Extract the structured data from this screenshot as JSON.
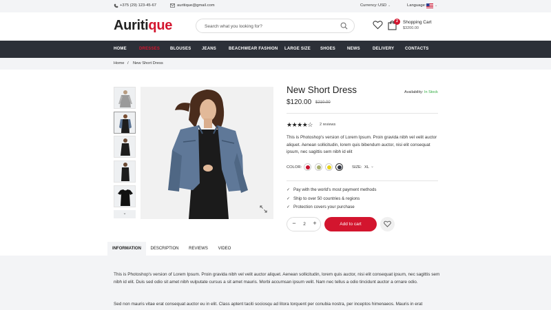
{
  "topbar": {
    "phone": "+375 (29) 123-45-67",
    "email": "auritique@gmail.com",
    "currency_label": "Currency:",
    "currency_value": "USD",
    "language_label": "Language:"
  },
  "header": {
    "logo_main": "Auriti",
    "logo_accent": "que",
    "search_placeholder": "Search what you looking for?",
    "cart_badge": "2",
    "cart_title": "Shopping Cart",
    "cart_amount": "$3200.00"
  },
  "nav": {
    "items": [
      "HOME",
      "DRESSES",
      "BLOUSES",
      "JEANS",
      "BEACHWEAR FASHION",
      "LARGE SIZE",
      "SHOES",
      "NEWS",
      "DELIVERY",
      "CONTACTS"
    ],
    "active_index": 1
  },
  "breadcrumb": {
    "home": "Home",
    "separator": "/",
    "current": "New Short Dress"
  },
  "gallery": {
    "more_glyph": "⌄"
  },
  "product": {
    "title": "New Short Dress",
    "availability_label": "Availability:",
    "availability_value": "In Stock",
    "price": "$120.00",
    "old_price": "$210.00",
    "rating": 4,
    "rating_max": 5,
    "reviews": "2 reviews",
    "description": "This is Photoshop's version  of Lorem Ipsum. Proin gravida nibh vel velit auctor aliquet. Aenean sollicitudin, lorem quis bibendum auctor, nisi elit consequat ipsum, nec sagittis sem nibh id elit",
    "color_label": "COLOR:",
    "colors": [
      "#c8102e",
      "#a8b070",
      "#e8d21a",
      "#2f3340"
    ],
    "selected_color_index": 3,
    "size_label": "SIZE:",
    "size_value": "XL",
    "features": [
      "Pay with the world's most payment methods",
      "Ship to over 50 countries & regions",
      "Protection covers your purchase"
    ],
    "quantity": "2",
    "add_to_cart": "Add to cart"
  },
  "tabs": {
    "items": [
      "INFORMATION",
      "DESCRIPTION",
      "REVIEWS",
      "VIDEO"
    ],
    "active_index": 0,
    "paragraphs": [
      "This is Photoshop's version  of Lorem Ipsum. Proin gravida nibh vel velit auctor aliquet. Aenean sollicitudin, lorem quis auctor, nisi elit consequat ipsum, nec sagittis sem nibh id elit. Duis sed odio sit amet nibh vulputate cursus a sit amet mauris. Morbi accumsan ipsum velit. Nam nec tellus a odio tincidunt auctor a ornare odio.",
      "Sed non  mauris vitae erat consequat auctor eu in elit. Class aptent taciti sociosqu ad litora torquent per conubia nostra, per inceptos himenaeos. Mauris in erat"
    ]
  },
  "colors": {
    "accent": "#d3152e",
    "nav_bg": "#2c3038",
    "in_stock": "#2eaa3e",
    "panel_bg": "#f3f4f6"
  }
}
